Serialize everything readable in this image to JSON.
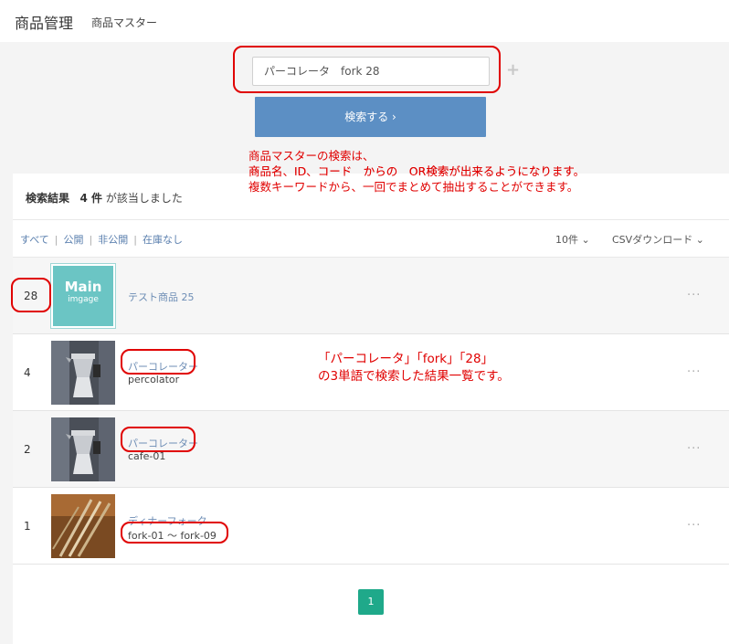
{
  "header": {
    "title": "商品管理",
    "subtitle": "商品マスター"
  },
  "search": {
    "value": "パーコレータ　fork 28",
    "button_label": "検索する ›"
  },
  "note_search": [
    "商品マスターの検索は、",
    "商品名、ID、コード　からの　OR検索が出来るようになります。",
    "複数キーワードから、一回でまとめて抽出することができます。"
  ],
  "results": {
    "label": "検索結果",
    "count": "4 件",
    "suffix": "が該当しました"
  },
  "filters": [
    "すべて",
    "公開",
    "非公開",
    "在庫なし"
  ],
  "page_size": "10件 ⌄",
  "csv_label": "CSVダウンロード ⌄",
  "main_image_text": {
    "line1": "Main",
    "line2": "imgage"
  },
  "products": [
    {
      "id": "28",
      "name": "テスト商品 25",
      "code": "",
      "thumb": "main-image-placeholder"
    },
    {
      "id": "4",
      "name": "パーコレーター",
      "code": "percolator",
      "thumb": "percolator-photo"
    },
    {
      "id": "2",
      "name": "パーコレーター",
      "code": "cafe-01",
      "thumb": "percolator-photo"
    },
    {
      "id": "1",
      "name": "ディナーフォーク",
      "code": "fork-01 〜 fork-09",
      "thumb": "fork-photo"
    }
  ],
  "row_menu": "···",
  "note_results": [
    "「パーコレータ」「fork」「28」",
    "の3単語で検索した結果一覧です。"
  ],
  "pagination": {
    "current": "1"
  },
  "colors": {
    "accent_blue": "#5c8fc4",
    "annotation_red": "#e00000",
    "page_green": "#1fa98a",
    "main_image_teal": "#6bc5c4"
  }
}
